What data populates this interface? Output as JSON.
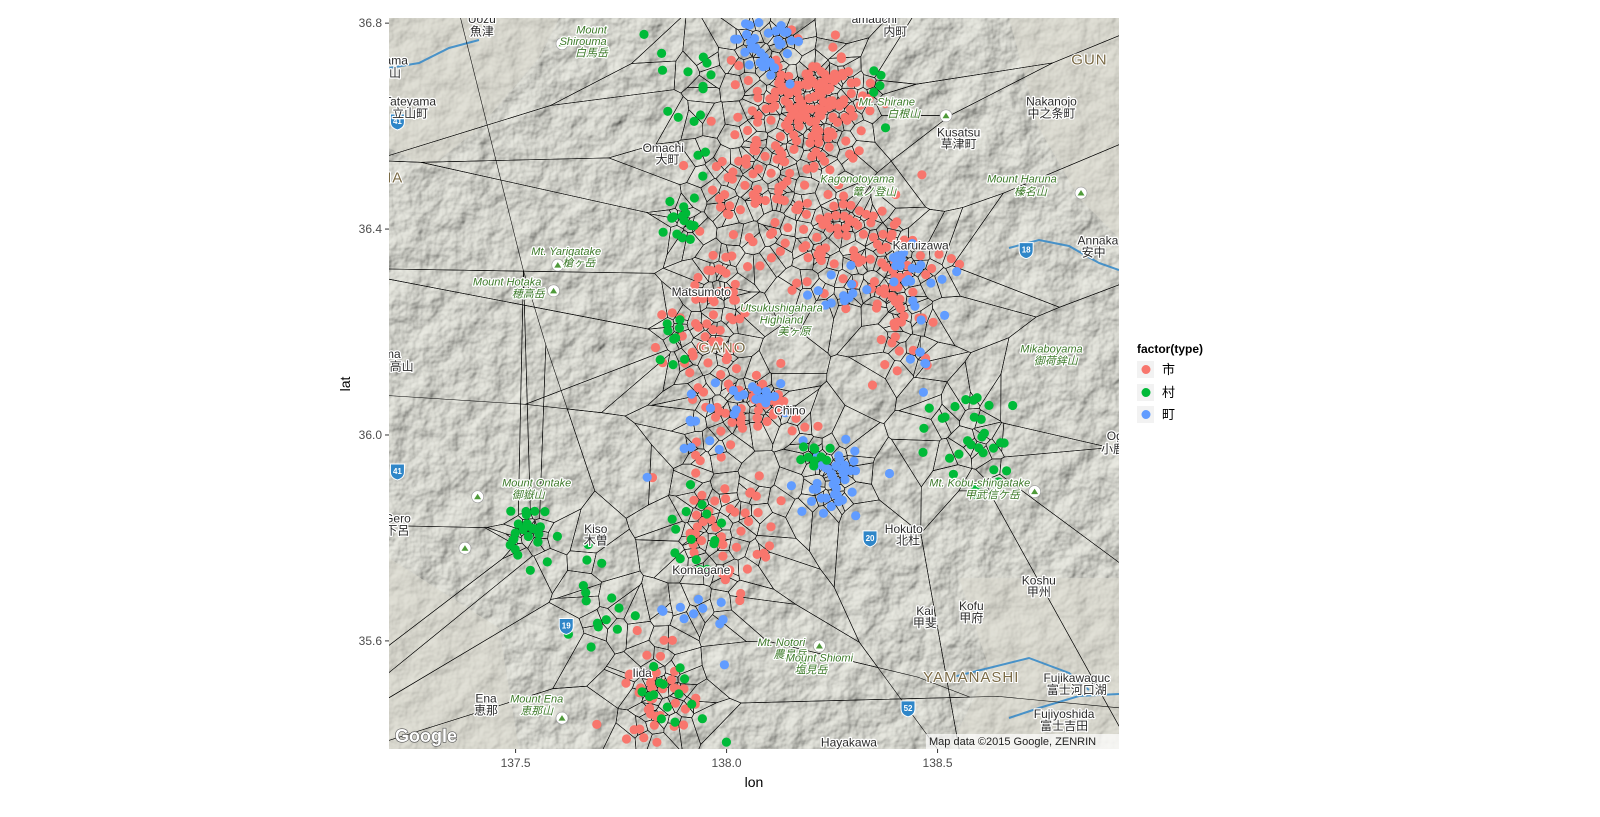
{
  "chart_data": {
    "type": "scatter",
    "xlabel": "lon",
    "ylabel": "lat",
    "xlim": [
      137.2,
      138.93
    ],
    "ylim": [
      35.39,
      36.81
    ],
    "x_ticks": [
      {
        "value": 137.5,
        "label": "137.5"
      },
      {
        "value": 138.0,
        "label": "138.0"
      },
      {
        "value": 138.5,
        "label": "138.5"
      }
    ],
    "y_ticks": [
      {
        "value": 35.6,
        "label": "35.6"
      },
      {
        "value": 36.0,
        "label": "36.0"
      },
      {
        "value": 36.4,
        "label": "36.4"
      },
      {
        "value": 36.8,
        "label": "36.8"
      }
    ],
    "grid": false,
    "legend": {
      "title": "factor(type)",
      "placement": "right",
      "entries": [
        {
          "key": "shi",
          "label": "市",
          "color": "#F8766D"
        },
        {
          "key": "son",
          "label": "村",
          "color": "#00BA38"
        },
        {
          "key": "cho",
          "label": "町",
          "color": "#619CFF"
        }
      ]
    },
    "overlay": "voronoi tessellation of the points (black lines)",
    "clusters": [
      {
        "type": "shi",
        "lon": 138.2,
        "lat": 36.64,
        "sd": [
          0.07,
          0.05
        ],
        "count": 150
      },
      {
        "type": "shi",
        "lon": 138.12,
        "lat": 36.52,
        "sd": [
          0.07,
          0.06
        ],
        "count": 55
      },
      {
        "type": "shi",
        "lon": 138.24,
        "lat": 36.39,
        "sd": [
          0.07,
          0.05
        ],
        "count": 55
      },
      {
        "type": "shi",
        "lon": 138.41,
        "lat": 36.29,
        "sd": [
          0.06,
          0.07
        ],
        "count": 70
      },
      {
        "type": "shi",
        "lon": 137.97,
        "lat": 36.22,
        "sd": [
          0.05,
          0.08
        ],
        "count": 60
      },
      {
        "type": "shi",
        "lon": 138.08,
        "lat": 36.06,
        "sd": [
          0.07,
          0.04
        ],
        "count": 40
      },
      {
        "type": "shi",
        "lon": 137.96,
        "lat": 35.85,
        "sd": [
          0.05,
          0.06
        ],
        "count": 35
      },
      {
        "type": "shi",
        "lon": 137.83,
        "lat": 35.5,
        "sd": [
          0.05,
          0.05
        ],
        "count": 45
      },
      {
        "type": "shi",
        "lon": 138.01,
        "lat": 36.4,
        "sd": [
          0.06,
          0.08
        ],
        "count": 20
      },
      {
        "type": "shi",
        "lon": 138.03,
        "lat": 35.8,
        "sd": [
          0.05,
          0.08
        ],
        "count": 18
      },
      {
        "type": "cho",
        "lon": 138.1,
        "lat": 36.76,
        "sd": [
          0.05,
          0.04
        ],
        "count": 40
      },
      {
        "type": "cho",
        "lon": 138.44,
        "lat": 36.31,
        "sd": [
          0.05,
          0.03
        ],
        "count": 20
      },
      {
        "type": "cho",
        "lon": 138.25,
        "lat": 35.91,
        "sd": [
          0.04,
          0.04
        ],
        "count": 40
      },
      {
        "type": "cho",
        "lon": 138.08,
        "lat": 36.07,
        "sd": [
          0.03,
          0.02
        ],
        "count": 15
      },
      {
        "type": "cho",
        "lon": 138.28,
        "lat": 36.27,
        "sd": [
          0.04,
          0.03
        ],
        "count": 12
      },
      {
        "type": "cho",
        "lon": 137.92,
        "lat": 35.63,
        "sd": [
          0.04,
          0.05
        ],
        "count": 12
      },
      {
        "type": "cho",
        "lon": 137.93,
        "lat": 36.02,
        "sd": [
          0.04,
          0.05
        ],
        "count": 12
      },
      {
        "type": "cho",
        "lon": 138.47,
        "lat": 36.15,
        "sd": [
          0.03,
          0.04
        ],
        "count": 8
      },
      {
        "type": "son",
        "lon": 137.53,
        "lat": 35.82,
        "sd": [
          0.03,
          0.03
        ],
        "count": 25
      },
      {
        "type": "son",
        "lon": 137.89,
        "lat": 36.42,
        "sd": [
          0.02,
          0.02
        ],
        "count": 15
      },
      {
        "type": "son",
        "lon": 138.56,
        "lat": 36.0,
        "sd": [
          0.06,
          0.05
        ],
        "count": 30
      },
      {
        "type": "son",
        "lon": 137.94,
        "lat": 35.8,
        "sd": [
          0.03,
          0.06
        ],
        "count": 15
      },
      {
        "type": "son",
        "lon": 137.88,
        "lat": 36.18,
        "sd": [
          0.03,
          0.03
        ],
        "count": 10
      },
      {
        "type": "son",
        "lon": 138.21,
        "lat": 35.96,
        "sd": [
          0.03,
          0.02
        ],
        "count": 10
      },
      {
        "type": "son",
        "lon": 137.87,
        "lat": 35.48,
        "sd": [
          0.05,
          0.04
        ],
        "count": 15
      },
      {
        "type": "son",
        "lon": 137.7,
        "lat": 35.68,
        "sd": [
          0.04,
          0.06
        ],
        "count": 15
      },
      {
        "type": "son",
        "lon": 137.93,
        "lat": 36.6,
        "sd": [
          0.03,
          0.08
        ],
        "count": 12
      },
      {
        "type": "son",
        "lon": 138.36,
        "lat": 36.66,
        "sd": [
          0.02,
          0.04
        ],
        "count": 5
      },
      {
        "type": "son",
        "lon": 137.87,
        "lat": 36.75,
        "sd": [
          0.03,
          0.04
        ],
        "count": 6
      }
    ]
  },
  "map": {
    "attribution": "Map data ©2015 Google, ZENRIN",
    "logo": "Google",
    "colors": {
      "background": "#a9ab9f",
      "lowland": "#dad8ce",
      "road": "#2f86c8",
      "water": "#6aa9d6",
      "voronoi": "#000000"
    },
    "places": [
      {
        "name": "Uozu",
        "lon": 137.42,
        "lat": 36.8,
        "style": "plain"
      },
      {
        "name": "魚津",
        "lon": 137.42,
        "lat": 36.776,
        "style": "plain"
      },
      {
        "name": "yama",
        "lon": 137.21,
        "lat": 36.72,
        "style": "plain"
      },
      {
        "name": "富山",
        "lon": 137.2,
        "lat": 36.695,
        "style": "plain"
      },
      {
        "name": "Tateyama",
        "lon": 137.25,
        "lat": 36.64,
        "style": "plain"
      },
      {
        "name": "立山町",
        "lon": 137.25,
        "lat": 36.617,
        "style": "plain"
      },
      {
        "name": "Mount",
        "lon": 137.68,
        "lat": 36.78,
        "style": "green"
      },
      {
        "name": "Shirouma",
        "lon": 137.66,
        "lat": 36.758,
        "style": "green"
      },
      {
        "name": "白馬岳",
        "lon": 137.68,
        "lat": 36.735,
        "style": "green"
      },
      {
        "name": "Omachi",
        "lon": 137.85,
        "lat": 36.55,
        "style": "plain"
      },
      {
        "name": "大町",
        "lon": 137.86,
        "lat": 36.527,
        "style": "plain"
      },
      {
        "name": "YAMA",
        "lon": 137.18,
        "lat": 36.49,
        "style": "region"
      },
      {
        "name": "Mt. Yarigatake",
        "lon": 137.62,
        "lat": 36.35,
        "style": "green"
      },
      {
        "name": "槍ヶ岳",
        "lon": 137.65,
        "lat": 36.327,
        "style": "green"
      },
      {
        "name": "Mount Hotaka",
        "lon": 137.48,
        "lat": 36.29,
        "style": "green"
      },
      {
        "name": "穂高岳",
        "lon": 137.53,
        "lat": 36.267,
        "style": "green"
      },
      {
        "name": "da",
        "lon": 137.18,
        "lat": 36.28,
        "style": "plain"
      },
      {
        "name": "騨",
        "lon": 137.18,
        "lat": 36.255,
        "style": "plain"
      },
      {
        "name": "akayama",
        "lon": 137.17,
        "lat": 36.15,
        "style": "plain"
      },
      {
        "name": "高山",
        "lon": 137.23,
        "lat": 36.125,
        "style": "plain"
      },
      {
        "name": "Matsumoto",
        "lon": 137.94,
        "lat": 36.27,
        "style": "plain"
      },
      {
        "name": "Utsukushigahara",
        "lon": 138.13,
        "lat": 36.24,
        "style": "green"
      },
      {
        "name": "Highland",
        "lon": 138.13,
        "lat": 36.217,
        "style": "green"
      },
      {
        "name": "美ヶ原",
        "lon": 138.16,
        "lat": 36.194,
        "style": "green"
      },
      {
        "name": "GANO",
        "lon": 137.99,
        "lat": 36.16,
        "style": "region"
      },
      {
        "name": "Kagonotoyama",
        "lon": 138.31,
        "lat": 36.49,
        "style": "green"
      },
      {
        "name": "篭ノ登山",
        "lon": 138.35,
        "lat": 36.465,
        "style": "green"
      },
      {
        "name": "Mt. Shirane",
        "lon": 138.38,
        "lat": 36.64,
        "style": "green"
      },
      {
        "name": "白根山",
        "lon": 138.42,
        "lat": 36.617,
        "style": "green"
      },
      {
        "name": "amauchi",
        "lon": 138.35,
        "lat": 36.8,
        "style": "plain"
      },
      {
        "name": "内町",
        "lon": 138.4,
        "lat": 36.776,
        "style": "plain"
      },
      {
        "name": "Nakanojo",
        "lon": 138.77,
        "lat": 36.64,
        "style": "plain"
      },
      {
        "name": "中之条町",
        "lon": 138.77,
        "lat": 36.617,
        "style": "plain"
      },
      {
        "name": "Kusatsu",
        "lon": 138.55,
        "lat": 36.58,
        "style": "plain"
      },
      {
        "name": "草津町",
        "lon": 138.55,
        "lat": 36.557,
        "style": "plain"
      },
      {
        "name": "GUN",
        "lon": 138.86,
        "lat": 36.72,
        "style": "region"
      },
      {
        "name": "Mount Haruna",
        "lon": 138.7,
        "lat": 36.49,
        "style": "green"
      },
      {
        "name": "榛名山",
        "lon": 138.72,
        "lat": 36.465,
        "style": "green"
      },
      {
        "name": "Karuizawa",
        "lon": 138.46,
        "lat": 36.36,
        "style": "plain"
      },
      {
        "name": "Annaka",
        "lon": 138.88,
        "lat": 36.37,
        "style": "plain"
      },
      {
        "name": "安中",
        "lon": 138.87,
        "lat": 36.347,
        "style": "plain"
      },
      {
        "name": "Mikaboyama",
        "lon": 138.77,
        "lat": 36.16,
        "style": "green"
      },
      {
        "name": "御荷鉾山",
        "lon": 138.78,
        "lat": 36.137,
        "style": "green"
      },
      {
        "name": "Chino",
        "lon": 138.15,
        "lat": 36.04,
        "style": "plain"
      },
      {
        "name": "Og",
        "lon": 138.92,
        "lat": 35.99,
        "style": "plain"
      },
      {
        "name": "小鹿野",
        "lon": 138.93,
        "lat": 35.965,
        "style": "plain"
      },
      {
        "name": "Mt. Kobu-shingatake",
        "lon": 138.6,
        "lat": 35.9,
        "style": "green"
      },
      {
        "name": "甲武信ケ岳",
        "lon": 138.63,
        "lat": 35.877,
        "style": "green"
      },
      {
        "name": "Mount Ontake",
        "lon": 137.55,
        "lat": 35.9,
        "style": "green"
      },
      {
        "name": "御嶽山",
        "lon": 137.53,
        "lat": 35.877,
        "style": "green"
      },
      {
        "name": "Gero",
        "lon": 137.22,
        "lat": 35.83,
        "style": "plain"
      },
      {
        "name": "下呂",
        "lon": 137.22,
        "lat": 35.807,
        "style": "plain"
      },
      {
        "name": "Kiso",
        "lon": 137.69,
        "lat": 35.81,
        "style": "plain"
      },
      {
        "name": "木曽",
        "lon": 137.69,
        "lat": 35.787,
        "style": "plain"
      },
      {
        "name": "Komagane",
        "lon": 137.94,
        "lat": 35.73,
        "style": "plain"
      },
      {
        "name": "Hokuto",
        "lon": 138.42,
        "lat": 35.81,
        "style": "plain"
      },
      {
        "name": "北杜",
        "lon": 138.43,
        "lat": 35.787,
        "style": "plain"
      },
      {
        "name": "Koshu",
        "lon": 138.74,
        "lat": 35.71,
        "style": "plain"
      },
      {
        "name": "甲州",
        "lon": 138.74,
        "lat": 35.687,
        "style": "plain"
      },
      {
        "name": "Kai",
        "lon": 138.47,
        "lat": 35.65,
        "style": "plain"
      },
      {
        "name": "甲斐",
        "lon": 138.47,
        "lat": 35.627,
        "style": "plain"
      },
      {
        "name": "Kofu",
        "lon": 138.58,
        "lat": 35.66,
        "style": "plain"
      },
      {
        "name": "甲府",
        "lon": 138.58,
        "lat": 35.637,
        "style": "plain"
      },
      {
        "name": "Mt. Notori",
        "lon": 138.13,
        "lat": 35.59,
        "style": "green"
      },
      {
        "name": "農鳥岳",
        "lon": 138.15,
        "lat": 35.567,
        "style": "green"
      },
      {
        "name": "Mount Shiomi",
        "lon": 138.22,
        "lat": 35.56,
        "style": "green"
      },
      {
        "name": "塩見岳",
        "lon": 138.2,
        "lat": 35.537,
        "style": "green"
      },
      {
        "name": "YAMANASHI",
        "lon": 138.58,
        "lat": 35.52,
        "style": "region"
      },
      {
        "name": "Fujikawaguc",
        "lon": 138.83,
        "lat": 35.52,
        "style": "plain"
      },
      {
        "name": "富士河口湖",
        "lon": 138.83,
        "lat": 35.497,
        "style": "plain"
      },
      {
        "name": "Fujiyoshida",
        "lon": 138.8,
        "lat": 35.45,
        "style": "plain"
      },
      {
        "name": "富士吉田",
        "lon": 138.8,
        "lat": 35.427,
        "style": "plain"
      },
      {
        "name": "Iida",
        "lon": 137.8,
        "lat": 35.53,
        "style": "plain"
      },
      {
        "name": "Ena",
        "lon": 137.43,
        "lat": 35.48,
        "style": "plain"
      },
      {
        "name": "恵那",
        "lon": 137.43,
        "lat": 35.457,
        "style": "plain"
      },
      {
        "name": "Mount Ena",
        "lon": 137.55,
        "lat": 35.48,
        "style": "green"
      },
      {
        "name": "恵那山",
        "lon": 137.55,
        "lat": 35.457,
        "style": "green"
      },
      {
        "name": "Hayakawa",
        "lon": 138.29,
        "lat": 35.395,
        "style": "plain"
      }
    ],
    "route_shields": [
      {
        "label": "41",
        "lon": 137.22,
        "lat": 36.61,
        "color": "#2f86c8"
      },
      {
        "label": "41",
        "lon": 137.22,
        "lat": 35.93,
        "color": "#2f86c8"
      },
      {
        "label": "18",
        "lon": 138.71,
        "lat": 36.36,
        "color": "#2f86c8"
      },
      {
        "label": "19",
        "lon": 137.62,
        "lat": 35.63,
        "color": "#2f86c8"
      },
      {
        "label": "20",
        "lon": 138.34,
        "lat": 35.8,
        "color": "#2f86c8"
      },
      {
        "label": "52",
        "lon": 138.43,
        "lat": 35.47,
        "color": "#2f86c8"
      }
    ],
    "peaks": [
      {
        "lon": 137.61,
        "lat": 36.76
      },
      {
        "lon": 137.6,
        "lat": 36.33
      },
      {
        "lon": 137.59,
        "lat": 36.28
      },
      {
        "lon": 138.1,
        "lat": 36.22
      },
      {
        "lon": 138.52,
        "lat": 36.62
      },
      {
        "lon": 138.84,
        "lat": 36.47
      },
      {
        "lon": 138.97,
        "lat": 36.14
      },
      {
        "lon": 138.73,
        "lat": 35.89
      },
      {
        "lon": 137.41,
        "lat": 35.88
      },
      {
        "lon": 137.38,
        "lat": 35.78
      },
      {
        "lon": 138.22,
        "lat": 35.59
      },
      {
        "lon": 138.18,
        "lat": 35.56
      },
      {
        "lon": 137.61,
        "lat": 35.45
      }
    ]
  }
}
